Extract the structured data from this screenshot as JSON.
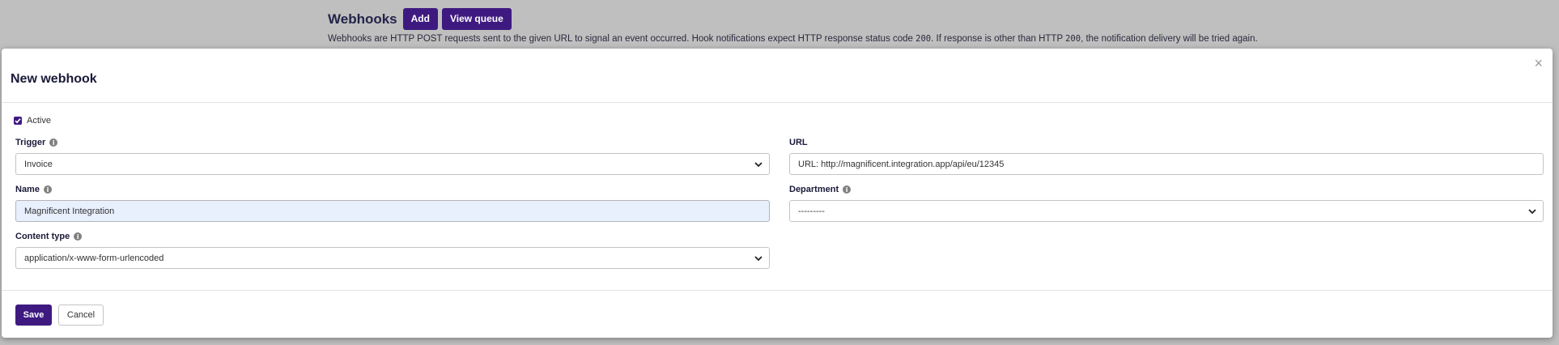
{
  "header": {
    "title": "Webhooks",
    "add_label": "Add",
    "view_queue_label": "View queue",
    "desc_part1": "Webhooks are HTTP POST requests sent to the given URL to signal an event occurred. Hook notifications expect HTTP response status code ",
    "desc_code1": "200",
    "desc_part2": ". If response is other than HTTP ",
    "desc_code2": "200",
    "desc_part3": ", the notification delivery will be tried again."
  },
  "modal": {
    "title": "New webhook",
    "close_glyph": "×",
    "active_label": "Active",
    "active_checked": true,
    "trigger": {
      "label": "Trigger",
      "value": "Invoice"
    },
    "name": {
      "label": "Name",
      "value": "Magnificent Integration"
    },
    "content_type": {
      "label": "Content type",
      "value": "application/x-www-form-urlencoded"
    },
    "url": {
      "label": "URL",
      "value": "URL: http://magnificent.integration.app/api/eu/12345"
    },
    "department": {
      "label": "Department",
      "value": "---------"
    },
    "save_label": "Save",
    "cancel_label": "Cancel"
  },
  "colors": {
    "accent": "#3e1a80",
    "backdrop": "#bfbfbf",
    "autofill": "#e8f0fe"
  }
}
